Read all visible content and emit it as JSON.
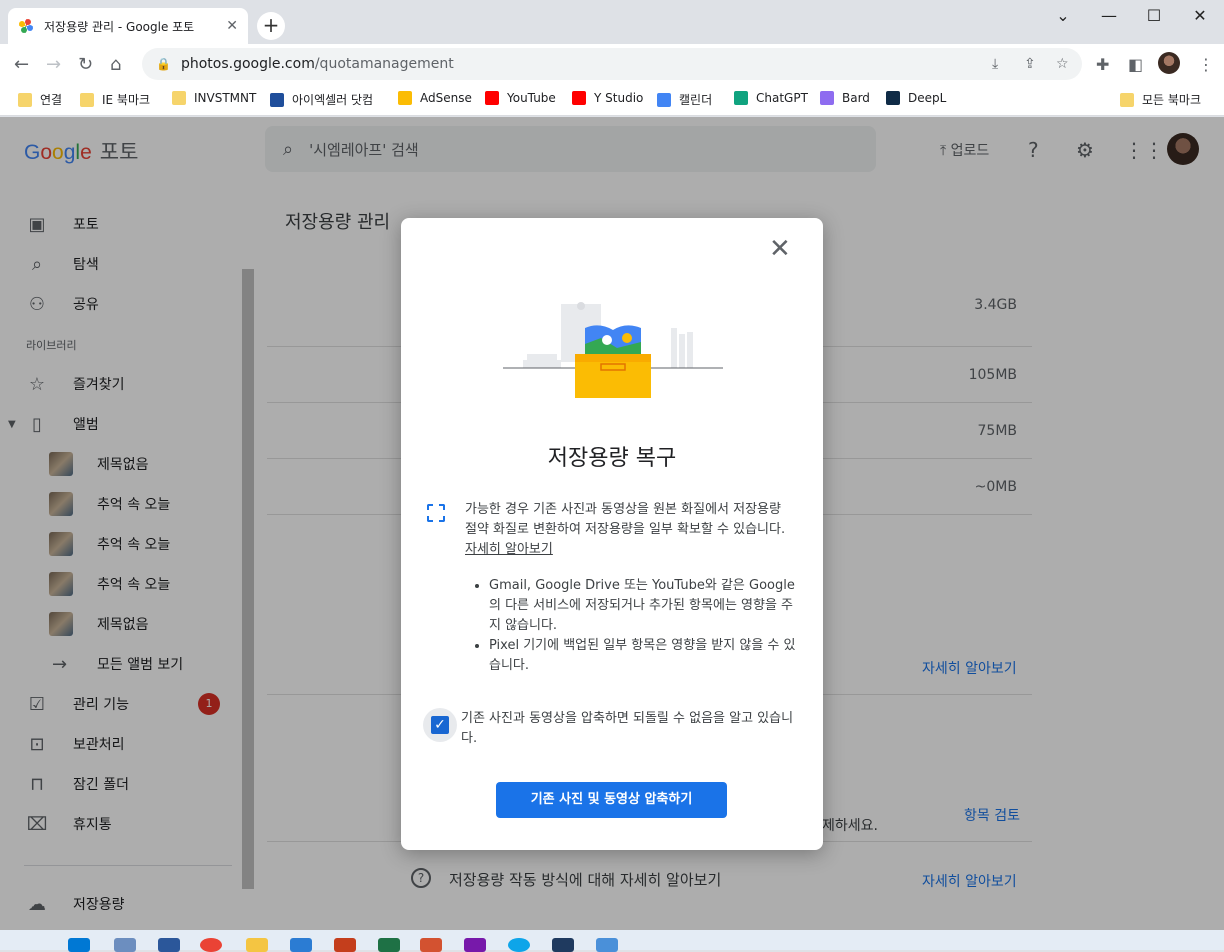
{
  "browser": {
    "tab_title": "저장용량 관리 - Google 포토",
    "url_domain": "photos.google.com",
    "url_path": "/quotamanagement"
  },
  "bookmarks": [
    {
      "label": "연결",
      "color": "#f6d46b"
    },
    {
      "label": "IE 북마크",
      "color": "#f6d46b"
    },
    {
      "label": "INVSTMNT",
      "color": "#f6d46b"
    },
    {
      "label": "아이엑셀러 닷컴",
      "color": "#1f4e9b"
    },
    {
      "label": "AdSense",
      "color": "#fbbc04"
    },
    {
      "label": "YouTube",
      "color": "#ff0000"
    },
    {
      "label": "Y Studio",
      "color": "#ff0000"
    },
    {
      "label": "캘린더",
      "color": "#4285f4"
    },
    {
      "label": "ChatGPT",
      "color": "#10a37f"
    },
    {
      "label": "Bard",
      "color": "#8e6cf0"
    },
    {
      "label": "DeepL",
      "color": "#0f2b46"
    }
  ],
  "bookmarks_right": "모든 북마크",
  "header": {
    "logo": "Google",
    "product": "포토",
    "search_placeholder": "'시엠레아프' 검색",
    "upload": "업로드"
  },
  "sidebar": {
    "items": [
      {
        "label": "포토",
        "icon": "□"
      },
      {
        "label": "탐색",
        "icon": "⌕"
      },
      {
        "label": "공유",
        "icon": "👥"
      }
    ],
    "library_heading": "라이브러리",
    "library": [
      {
        "label": "즐겨찾기",
        "icon": "☆"
      },
      {
        "label": "앨범",
        "icon": "▯"
      }
    ],
    "albums": [
      "제목없음",
      "추억 속 오늘",
      "추억 속 오늘",
      "추억 속 오늘",
      "제목없음"
    ],
    "all_albums": "모든 앨범 보기",
    "tools": [
      {
        "label": "관리 기능",
        "icon": "☑"
      },
      {
        "label": "보관처리",
        "icon": "⊡"
      },
      {
        "label": "잠긴 폴더",
        "icon": "🔒"
      },
      {
        "label": "휴지통",
        "icon": "🗑"
      }
    ],
    "badge": "1",
    "storage": "저장용량"
  },
  "main": {
    "title": "저장용량 관리",
    "sizes": [
      "3.4GB",
      "105MB",
      "75MB",
      "~0MB"
    ],
    "learn_more": "자세히 알아보기",
    "review_items": "항목 검토",
    "partial_text": "제하세요.",
    "help_text": "저장용량 작동 방식에 대해 자세히 알아보기",
    "help_link": "자세히 알아보기"
  },
  "dialog": {
    "title": "저장용량 복구",
    "para": "가능한 경우 기존 사진과 동영상을 원본 화질에서 저장용량 절약 화질로 변환하여 저장용량을 일부 확보할 수 있습니다.",
    "para_link": "자세히 알아보기",
    "bullets": [
      "Gmail, Google Drive 또는 YouTube와 같은 Google의 다른 서비스에 저장되거나 추가된 항목에는 영향을 주지 않습니다.",
      "Pixel 기기에 백업된 일부 항목은 영향을 받지 않을 수 있습니다."
    ],
    "checkbox_label": "기존 사진과 동영상을 압축하면 되돌릴 수 없음을 알고 있습니다.",
    "checkbox_checked": true,
    "button": "기존 사진 및 동영상 압축하기"
  }
}
